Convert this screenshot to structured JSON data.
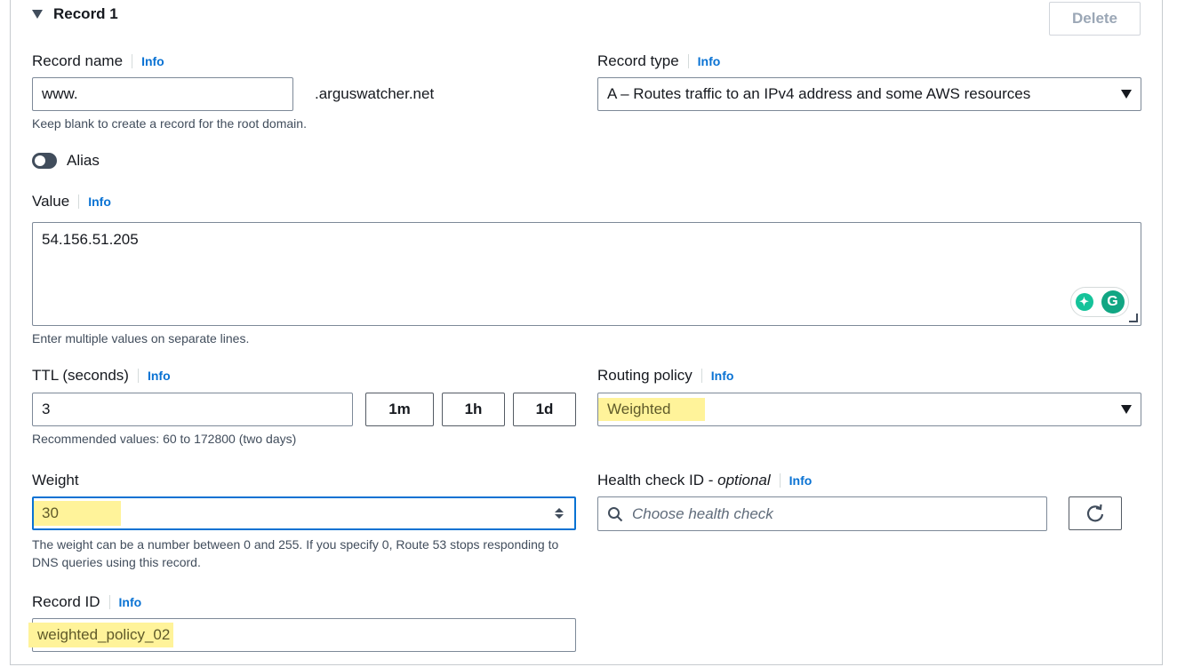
{
  "record": {
    "title": "Record 1",
    "delete_label": "Delete"
  },
  "record_name": {
    "label": "Record name",
    "info": "Info",
    "value": "www.",
    "domain_suffix": ".arguswatcher.net",
    "hint": "Keep blank to create a record for the root domain."
  },
  "record_type": {
    "label": "Record type",
    "info": "Info",
    "selected": "A – Routes traffic to an IPv4 address and some AWS resources"
  },
  "alias": {
    "label": "Alias",
    "enabled": false
  },
  "value": {
    "label": "Value",
    "info": "Info",
    "text": "54.156.51.205",
    "hint": "Enter multiple values on separate lines."
  },
  "ttl": {
    "label": "TTL (seconds)",
    "info": "Info",
    "value": "3",
    "presets": [
      "1m",
      "1h",
      "1d"
    ],
    "hint": "Recommended values: 60 to 172800 (two days)"
  },
  "routing_policy": {
    "label": "Routing policy",
    "info": "Info",
    "selected": "Weighted"
  },
  "weight": {
    "label": "Weight",
    "value": "30",
    "hint": "The weight can be a number between 0 and 255. If you specify 0, Route 53 stops responding to DNS queries using this record."
  },
  "health_check": {
    "label": "Health check ID - ",
    "label_optional": "optional",
    "info": "Info",
    "placeholder": "Choose health check"
  },
  "record_id": {
    "label": "Record ID",
    "info": "Info",
    "value": "weighted_policy_02"
  },
  "colors": {
    "link": "#0972d3",
    "highlight": "#fff39a",
    "focus_border": "#0972d3",
    "grammarly_green": "#15c39a"
  }
}
